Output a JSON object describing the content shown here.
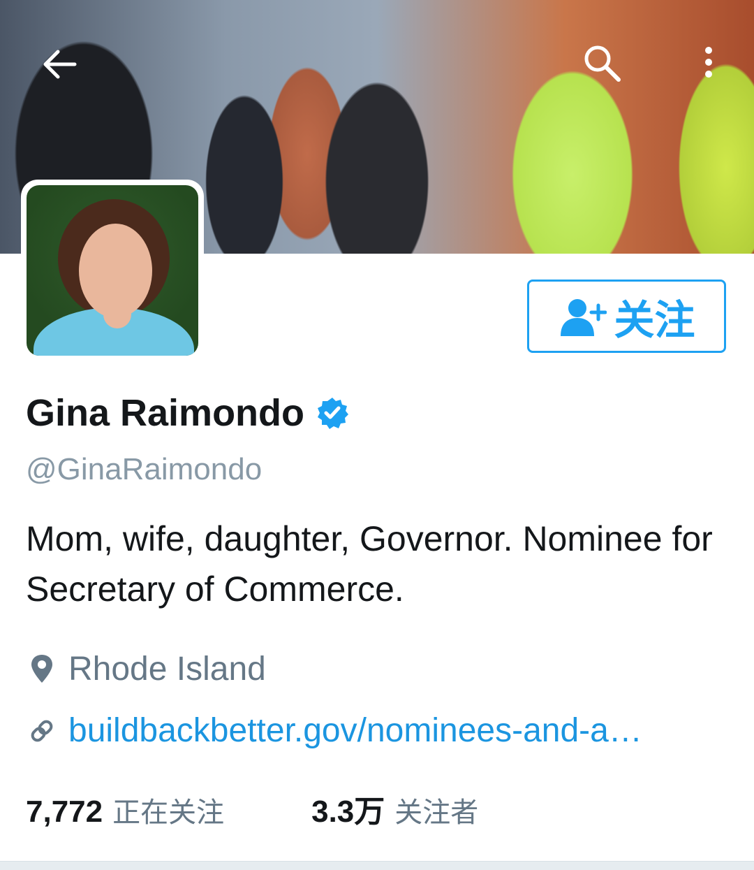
{
  "profile": {
    "name": "Gina Raimondo",
    "handle": "@GinaRaimondo",
    "bio": "Mom, wife, daughter, Governor. Nominee for Secretary of Commerce.",
    "location": "Rhode Island",
    "url": "buildbackbetter.gov/nominees-and-a…",
    "verified": true
  },
  "actions": {
    "follow_label": "关注"
  },
  "stats": {
    "following_count": "7,772",
    "following_label": "正在关注",
    "followers_count": "3.3万",
    "followers_label": "关注者"
  },
  "icons": {
    "back": "back-arrow-icon",
    "search": "search-icon",
    "more": "more-vertical-icon",
    "follow": "add-person-icon",
    "verified": "verified-badge-icon",
    "location": "map-pin-icon",
    "link": "link-icon"
  },
  "colors": {
    "accent": "#1da1f2",
    "link": "#1b95e0",
    "muted": "#657786",
    "text": "#14171a"
  }
}
